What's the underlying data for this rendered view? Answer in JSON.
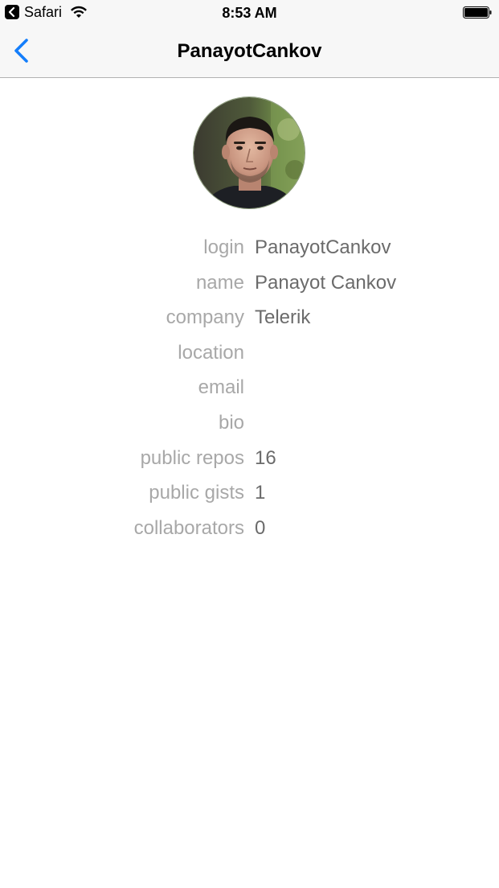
{
  "status_bar": {
    "back_app": "Safari",
    "time": "8:53 AM"
  },
  "nav": {
    "title": "PanayotCankov",
    "back_icon": "chevron-left-icon",
    "accent_color": "#147efb"
  },
  "profile": {
    "avatar_alt": "avatar",
    "rows": [
      {
        "label": "login",
        "value": "PanayotCankov"
      },
      {
        "label": "name",
        "value": "Panayot Cankov"
      },
      {
        "label": "company",
        "value": "Telerik"
      },
      {
        "label": "location",
        "value": ""
      },
      {
        "label": "email",
        "value": ""
      },
      {
        "label": "bio",
        "value": ""
      },
      {
        "label": "public repos",
        "value": "16"
      },
      {
        "label": "public gists",
        "value": "1"
      },
      {
        "label": "collaborators",
        "value": "0"
      }
    ]
  }
}
